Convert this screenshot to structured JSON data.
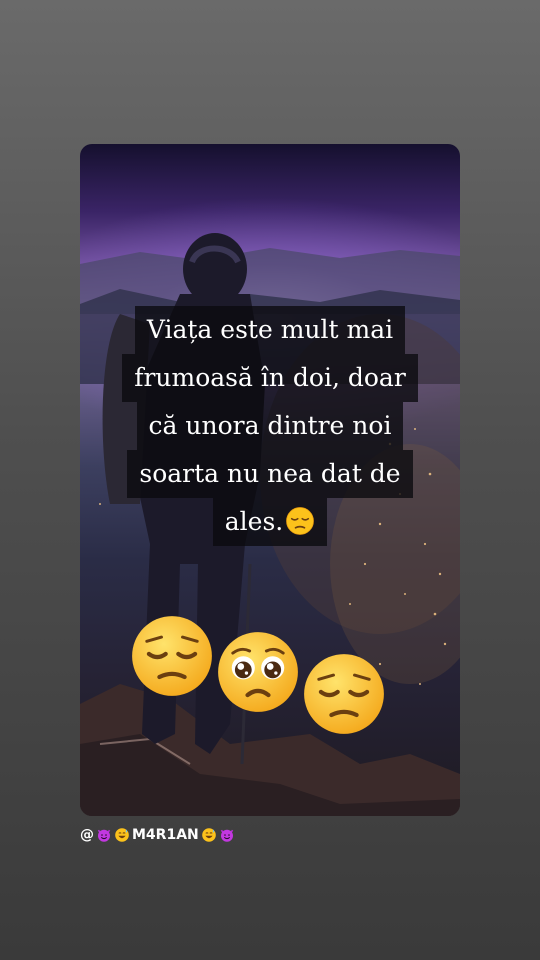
{
  "story": {
    "caption_lines": [
      "Viața este mult mai",
      "frumoasă în doi, doar",
      "că unora dintre noi",
      "soarta nu nea dat de",
      "ales."
    ],
    "stickers": [
      "pensive-face-icon",
      "pleading-face-icon",
      "pensive-face-icon"
    ],
    "caption_emoji": "pensive-face-icon"
  },
  "footer": {
    "at": "@",
    "username_text": "M4R1AN",
    "icons": [
      "smiling-imp-icon",
      "grinning-sweat-icon",
      "grinning-sweat-icon",
      "smiling-imp-icon"
    ]
  }
}
